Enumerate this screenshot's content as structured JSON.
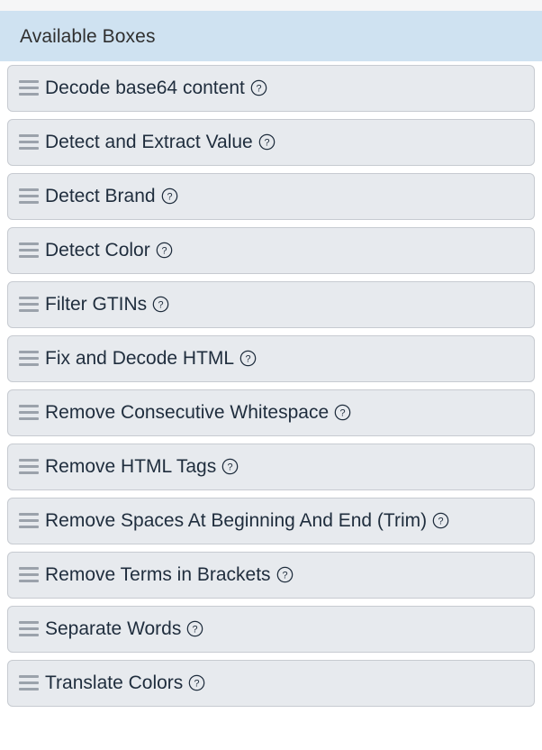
{
  "header": {
    "title": "Available Boxes",
    "background_color": "#cfe2f1",
    "text_color": "#2f2f2f"
  },
  "colors": {
    "page_background": "#ffffff",
    "top_strip": "#f6f6f7",
    "item_background": "#e7eaee",
    "item_border": "#c7cbd1",
    "item_text": "#1f2d3d",
    "drag_handle": "#9ba2ab"
  },
  "icons": {
    "drag_handle": "drag-handle-icon",
    "help": "help-circle-icon",
    "help_glyph": "?"
  },
  "list": {
    "items": [
      {
        "label": "Decode base64 content",
        "help": "?"
      },
      {
        "label": "Detect and Extract Value",
        "help": "?"
      },
      {
        "label": "Detect Brand",
        "help": "?"
      },
      {
        "label": "Detect Color",
        "help": "?"
      },
      {
        "label": "Filter GTINs",
        "help": "?"
      },
      {
        "label": "Fix and Decode HTML",
        "help": "?"
      },
      {
        "label": "Remove Consecutive Whitespace",
        "help": "?"
      },
      {
        "label": "Remove HTML Tags",
        "help": "?"
      },
      {
        "label": "Remove Spaces At Beginning And End (Trim)",
        "help": "?"
      },
      {
        "label": "Remove Terms in Brackets",
        "help": "?"
      },
      {
        "label": "Separate Words",
        "help": "?"
      },
      {
        "label": "Translate Colors",
        "help": "?"
      }
    ]
  }
}
